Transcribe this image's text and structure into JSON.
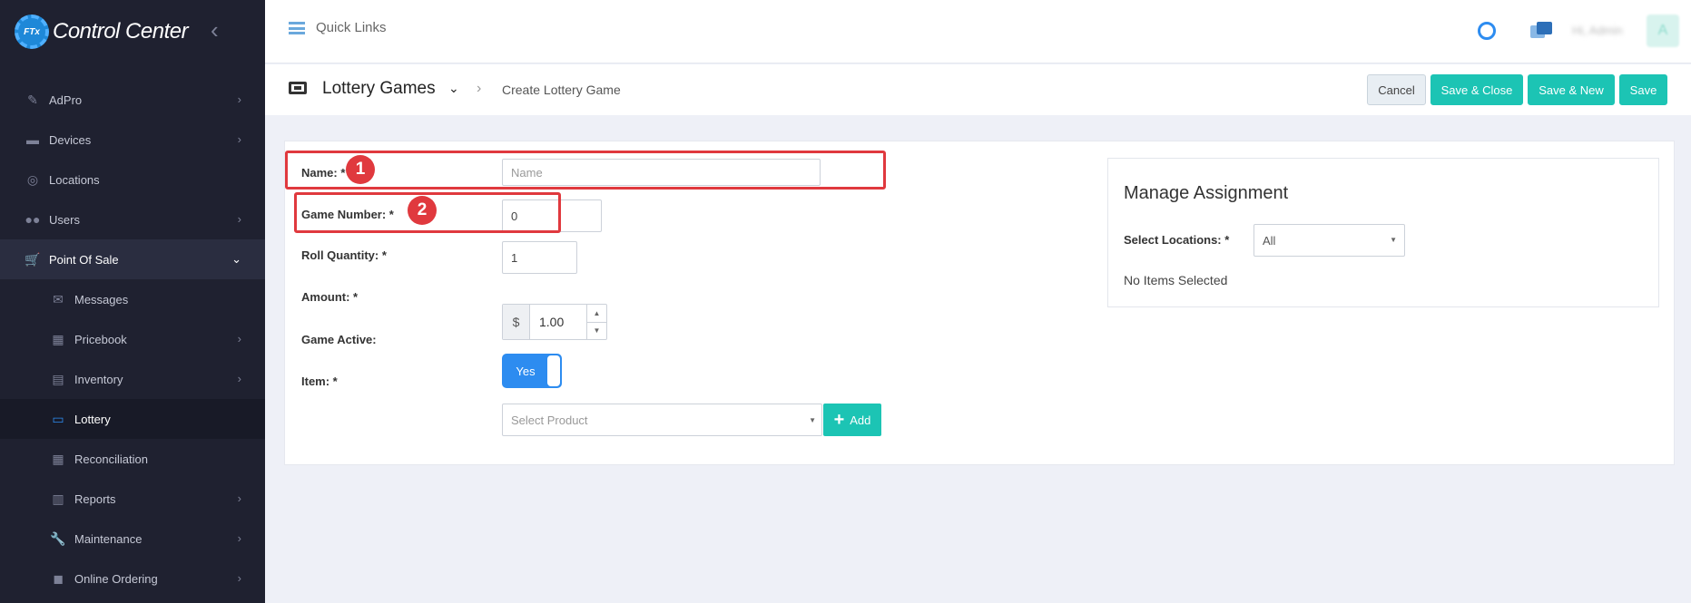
{
  "brand": {
    "logo_text": "FTx",
    "title": "Control Center"
  },
  "sidebar": {
    "items": [
      {
        "label": "AdPro",
        "icon": "brush-icon",
        "chevron": "›"
      },
      {
        "label": "Devices",
        "icon": "devices-icon",
        "chevron": "›"
      },
      {
        "label": "Locations",
        "icon": "map-pin-icon",
        "chevron": ""
      },
      {
        "label": "Users",
        "icon": "users-icon",
        "chevron": "›"
      },
      {
        "label": "Point Of Sale",
        "icon": "cart-icon",
        "chevron": "⌄"
      },
      {
        "label": "Messages",
        "icon": "messages-icon",
        "chevron": ""
      },
      {
        "label": "Pricebook",
        "icon": "calculator-icon",
        "chevron": "›"
      },
      {
        "label": "Inventory",
        "icon": "inventory-icon",
        "chevron": "›"
      },
      {
        "label": "Lottery",
        "icon": "ticket-icon",
        "chevron": ""
      },
      {
        "label": "Reconciliation",
        "icon": "grid-icon",
        "chevron": ""
      },
      {
        "label": "Reports",
        "icon": "bar-chart-icon",
        "chevron": "›"
      },
      {
        "label": "Maintenance",
        "icon": "wrench-icon",
        "chevron": "›"
      },
      {
        "label": "Online Ordering",
        "icon": "shopping-bag-icon",
        "chevron": "›"
      }
    ]
  },
  "topbar": {
    "quick_links": "Quick Links",
    "user_name": "Hi, Admin"
  },
  "breadcrumb": {
    "section": "Lottery Games",
    "current": "Create Lottery Game"
  },
  "actions": {
    "cancel": "Cancel",
    "save_close": "Save & Close",
    "save_new": "Save & New",
    "save": "Save"
  },
  "form": {
    "name_label": "Name: *",
    "name_placeholder": "Name",
    "name_value": "",
    "game_number_label": "Game Number: *",
    "game_number_value": "0",
    "roll_quantity_label": "Roll Quantity: *",
    "roll_quantity_value": "1",
    "amount_label": "Amount: *",
    "amount_currency": "$",
    "amount_value": "1.00",
    "game_active_label": "Game Active:",
    "game_active_value": "Yes",
    "item_label": "Item: *",
    "item_placeholder": "Select Product",
    "add_label": "Add"
  },
  "annotations": {
    "badge_1": "1",
    "badge_2": "2",
    "color": "#e0393e"
  },
  "assignment": {
    "title": "Manage Assignment",
    "locations_label": "Select Locations: *",
    "locations_value": "All",
    "empty_text": "No Items Selected"
  },
  "colors": {
    "sidebar": "#1f2130",
    "accent": "#1cc4b4",
    "primary": "#2d8cf0"
  }
}
